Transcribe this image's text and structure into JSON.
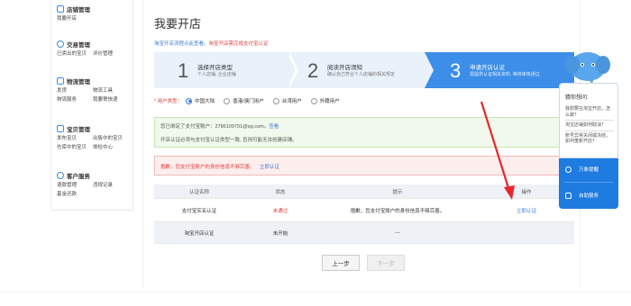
{
  "sidebar": {
    "groups": [
      {
        "title": "店铺管理",
        "icon": "shop-icon",
        "rows": [
          [
            "我要开店"
          ]
        ]
      },
      {
        "title": "交易管理",
        "icon": "trade-icon",
        "rows": [
          [
            "已卖出的宝贝",
            "评价管理"
          ]
        ]
      },
      {
        "title": "物流管理",
        "icon": "logistics-icon",
        "rows": [
          [
            "发货",
            "物流工具"
          ],
          [
            "物流服务",
            "我要寄快递"
          ]
        ]
      },
      {
        "title": "宝贝管理",
        "icon": "goods-icon",
        "rows": [
          [
            "发布宝贝",
            "出售中的宝贝"
          ],
          [
            "仓库中的宝贝",
            "体检中心"
          ]
        ]
      },
      {
        "title": "客户服务",
        "icon": "service-icon",
        "rows": [
          [
            "退款管理",
            "违规记录"
          ],
          [
            "基金还款"
          ]
        ]
      }
    ]
  },
  "page": {
    "title": "我要开店",
    "notice_prefix": "淘宝开店流程点此查看。",
    "notice_red": "淘宝开店需完成支付宝认证"
  },
  "steps": [
    {
      "num": "1",
      "title": "选择开店类型",
      "desc": "个人店铺, 企业店铺"
    },
    {
      "num": "2",
      "title": "阅读开店须知",
      "desc": "确认自己符合个人店铺的相关规定"
    },
    {
      "num": "3",
      "title": "申请开店认证",
      "desc": "需提供认证相关资料, 等待审核通过"
    }
  ],
  "user_type": {
    "label": "* 用户类型：",
    "options": [
      "中国大陆",
      "香港/澳门用户",
      "台湾用户",
      "外籍用户"
    ],
    "selected": "中国大陆"
  },
  "green_box": {
    "line1": "您已绑定了支付宝账户：2786109791@qq.com。",
    "line1_link": "查看",
    "line2": "开店认证必须与支付宝认证类型一致, 否则可能无法创建店铺。"
  },
  "red_box": {
    "text": "抱歉，您支付宝账户的身份信息不够完善。",
    "link": "立即认证"
  },
  "table": {
    "headers": [
      "认证名称",
      "状态",
      "提示",
      "操作"
    ],
    "rows": [
      {
        "name": "支付宝实名认证",
        "status": "未通过",
        "hint": "抱歉，您支付宝账户的身份信息不够完善。",
        "action": "立即认证"
      },
      {
        "name": "淘宝开店认证",
        "status": "未开始",
        "hint": "---",
        "action": ""
      }
    ]
  },
  "buttons": {
    "prev": "上一步",
    "next": "下一步"
  },
  "help_widget": {
    "question": "猜你想问:",
    "items": [
      "我想要在淘宝开店，怎么做？",
      "淘宝店铺如何取消？",
      "账号异常关闭或冻结，如何重新开店？"
    ],
    "btn1": "万象提醒",
    "btn2": "自助服务"
  },
  "colors": {
    "accent": "#3c8ee8",
    "error": "#e03c3c",
    "link": "#3a7bd5"
  }
}
